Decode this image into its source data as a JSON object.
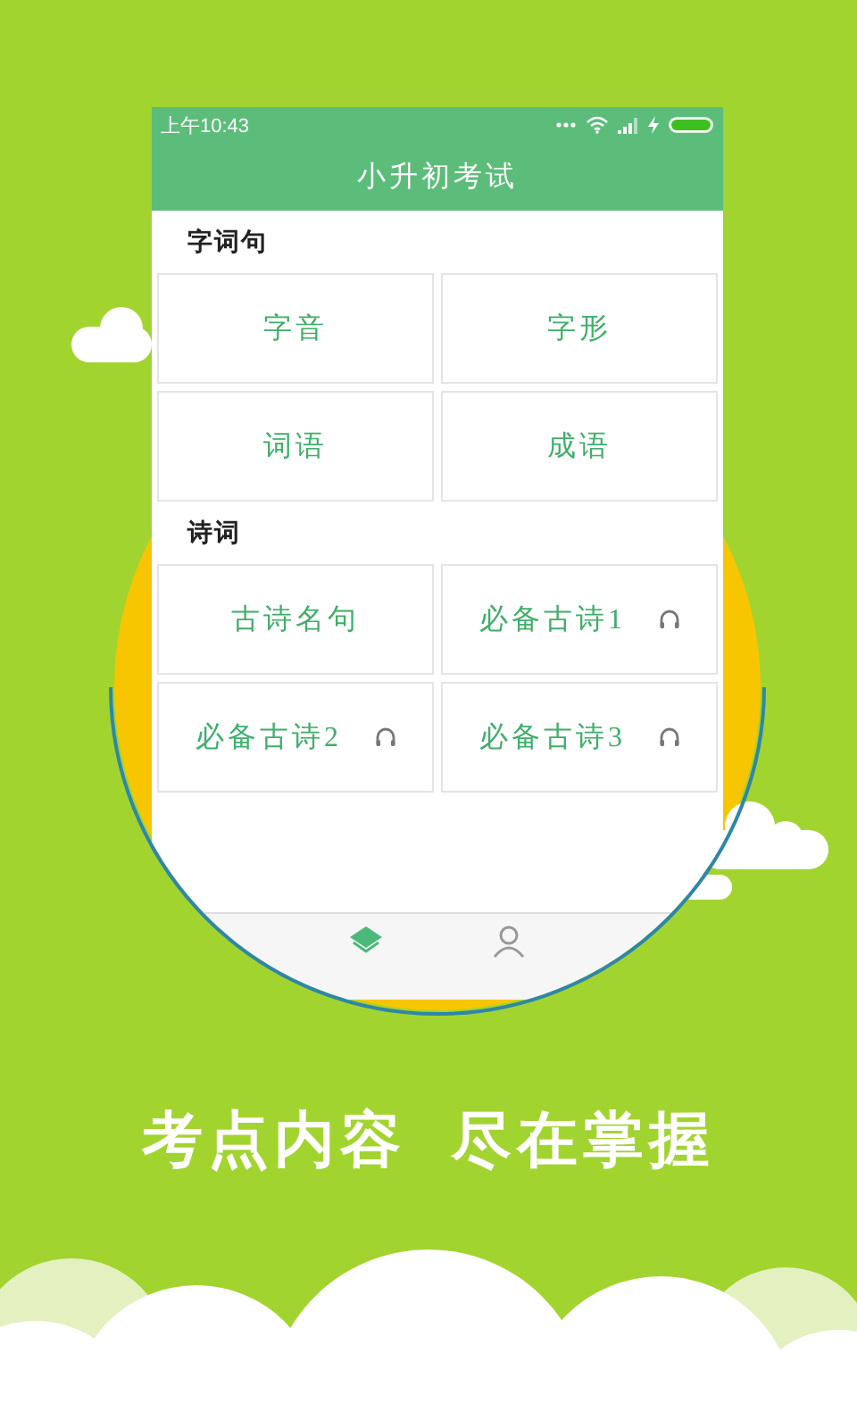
{
  "status_bar": {
    "time": "上午10:43"
  },
  "title": "小升初考试",
  "sections": [
    {
      "heading": "字词句",
      "items": [
        {
          "label": "字音",
          "audio": false
        },
        {
          "label": "字形",
          "audio": false
        },
        {
          "label": "词语",
          "audio": false
        },
        {
          "label": "成语",
          "audio": false
        }
      ]
    },
    {
      "heading": "诗词",
      "items": [
        {
          "label": "古诗名句",
          "audio": false
        },
        {
          "label": "必备古诗1",
          "audio": true
        },
        {
          "label": "必备古诗2",
          "audio": true
        },
        {
          "label": "必备古诗3",
          "audio": true
        }
      ]
    }
  ],
  "tabs": [
    {
      "selected": true
    },
    {
      "selected": false
    }
  ],
  "slogan": "考点内容 尽在掌握"
}
